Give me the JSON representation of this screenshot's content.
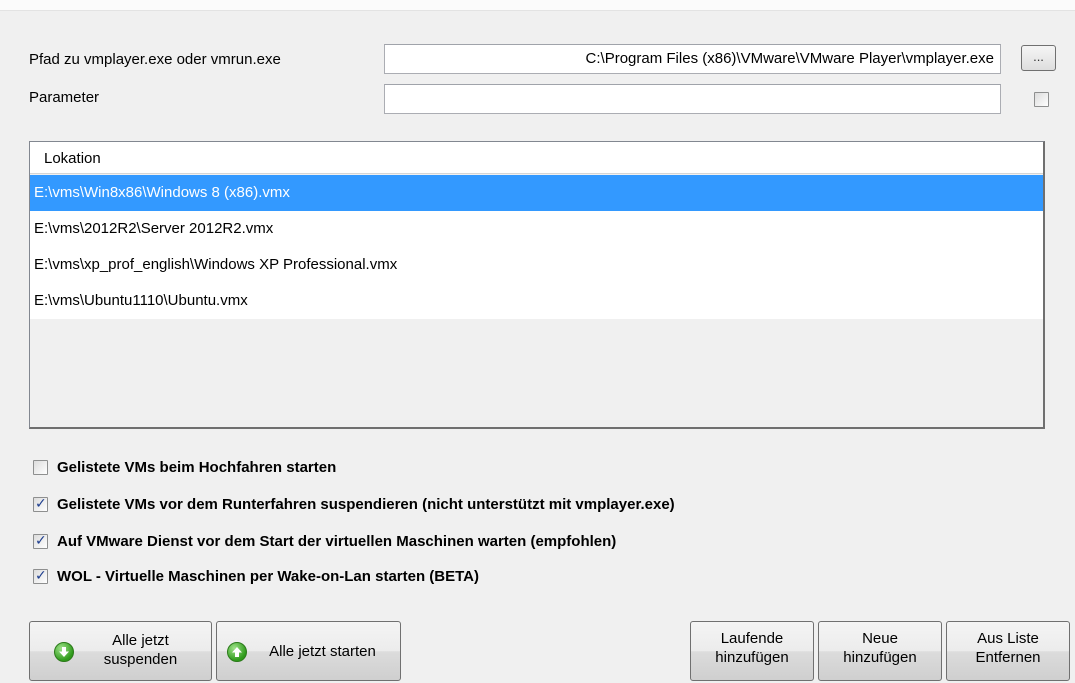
{
  "settings": {
    "path_label": "Pfad zu vmplayer.exe oder vmrun.exe",
    "path_value": "C:\\Program Files (x86)\\VMware\\VMware Player\\vmplayer.exe",
    "browse_label": "...",
    "parameter_label": "Parameter",
    "parameter_value": "",
    "parameter_checkbox_checked": false
  },
  "vm_list": {
    "column_header": "Lokation",
    "rows": [
      "E:\\vms\\Win8x86\\Windows 8 (x86).vmx",
      "E:\\vms\\2012R2\\Server 2012R2.vmx",
      "E:\\vms\\xp_prof_english\\Windows XP Professional.vmx",
      "E:\\vms\\Ubuntu1110\\Ubuntu.vmx"
    ],
    "selected_index": 0
  },
  "options": [
    {
      "label": "Gelistete VMs beim Hochfahren starten",
      "checked": false
    },
    {
      "label": "Gelistete VMs vor dem Runterfahren suspendieren (nicht unterstützt mit vmplayer.exe)",
      "checked": true
    },
    {
      "label": "Auf VMware Dienst vor dem Start der virtuellen Maschinen warten (empfohlen)",
      "checked": true
    },
    {
      "label": "WOL - Virtuelle Maschinen per Wake-on-Lan starten (BETA)",
      "checked": true
    }
  ],
  "buttons": {
    "suspend_all_line1": "Alle jetzt",
    "suspend_all_line2": "suspenden",
    "start_all": "Alle jetzt starten",
    "add_running_line1": "Laufende",
    "add_running_line2": "hinzufügen",
    "add_new_line1": "Neue",
    "add_new_line2": "hinzufügen",
    "remove_line1": "Aus Liste",
    "remove_line2": "Entfernen"
  },
  "icons": {
    "suspend": "green-down-arrow-icon",
    "start": "green-up-arrow-icon"
  },
  "colors": {
    "selection": "#3399ff",
    "icon_green": "#2f9a1b"
  }
}
